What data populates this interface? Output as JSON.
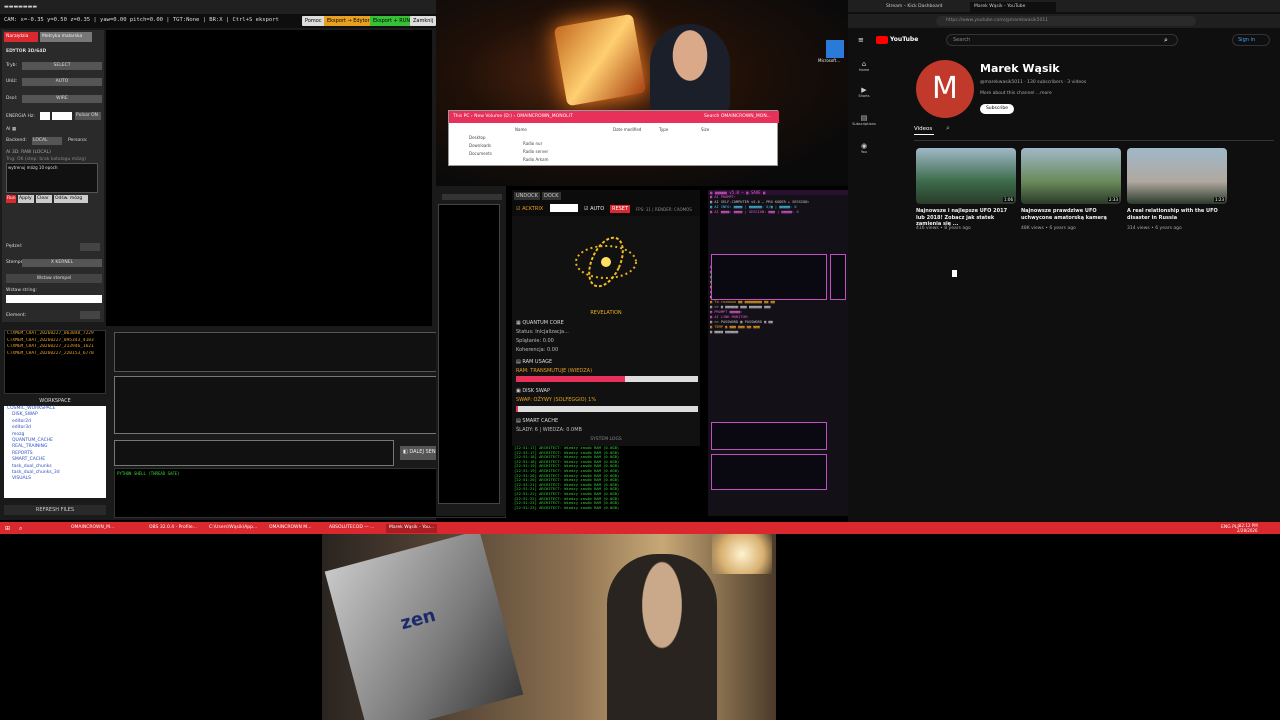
{
  "editor": {
    "window_title": "▬▬▬▬▬▬▬",
    "status": "CAM: x=-0.35 y=0.50 z=0.35 | yaw=0.00 pitch=0.00 | TGT:None | BR:X | Ctrl+S eksport",
    "buttons": {
      "help": "Pomoc",
      "export_editor": "Eksport → Edytor",
      "export_run": "Eksport + RUN",
      "close": "Zamknij"
    },
    "tabs": [
      "Narzędzia",
      "Metryka malarska"
    ],
    "panel_title": "EDYTOR 3D/64D",
    "fields": [
      {
        "label": "Tryb:",
        "value": "SELECT"
      },
      {
        "label": "Ułóż:",
        "value": "AUTO"
      },
      {
        "label": "Dsol:",
        "value": "WIRE"
      }
    ],
    "energia_label": "ENERGIA Hz:",
    "pulsar_label": "Pulsar ON",
    "ai_label": "AI ▦",
    "backend_label": "Backend:",
    "backend_value": "LOCAL",
    "persona_label": "Persona:",
    "ai_status": "AI 3D: RAW (LOCAL)",
    "ai_hint": "Trig: OK (step: brak katalogu mózg)",
    "ai_note": "wytrenuj mózg 10 epoch",
    "action_buttons": [
      "Run",
      "Apply",
      "Clear",
      "Odśw. mózg"
    ],
    "pedzel_label": "Pędzel:",
    "stempel_label": "Stempel:",
    "stempel_value": "X KERNEL",
    "wstaw_stempel": "Wstaw stempel",
    "wstaw_string": "Wstaw string:",
    "element_label": "Element:",
    "files": [
      "CTXMEM_CHAT_20260227_063048_7229",
      "CTXMEM_CHAT_20260227_095343_4183",
      "CTXMEM_CHAT_20260227_213946_1621",
      "CTXMEM_CHAT_20260227_220153_6770"
    ],
    "workspace_title": "WORKSPACE",
    "tree": [
      "COSMIC_WORKSPACE",
      "DISK_SWAP",
      "editor2d",
      "editor3d",
      "mozg",
      "QUANTUM_CACHE",
      "REAL_TRAINING",
      "REPORTS",
      "SMART_CACHE",
      "task_dual_chunks",
      "task_dual_chunks_3d",
      "VISUALS"
    ],
    "refresh": "REFRESH FILES",
    "bottom_buttons": "◧ DALEJ SEND UNDOCK DOCK",
    "console_title": "PYTHON SHELL (THREAD SAFE)"
  },
  "explorer": {
    "path": "This PC › New Volume (D:) › OMAINCROWN_MONOLIT",
    "search": "Search OMAINCROWN_MON...",
    "columns": [
      "Name",
      "Date modified",
      "Type",
      "Size"
    ],
    "sidebar": [
      "Desktop",
      "Downloads",
      "Documents"
    ],
    "rows": [
      "Radio nur",
      "Radio server",
      "Radio Arkam"
    ]
  },
  "desktop_icon": "Microsoft...",
  "quantum": {
    "head_buttons": [
      "UNDOCK",
      "DOCK"
    ],
    "mode": "☑ ACKTRIX",
    "auto": "☑ AUTO",
    "reset": "RESET",
    "fps": "FPS: 31 | RENDER: CAOMOS",
    "revelation": "REVELATION",
    "core_title": "▦ QUANTUM CORE",
    "core_status": "Status: Inicjalizacja...",
    "splatanie": "Splątanie: 0.00",
    "koherencja": "Koherencja: 0.00",
    "ram_title": "▤ RAM USAGE",
    "ram_value": "RAM: TRANSMUTUJE (WIEDZA)",
    "ram_fill": 0.6,
    "disk_title": "▣ DISK SWAP",
    "disk_value": "SWAP: OŻYWY (SOLFEGGIO) 1%",
    "disk_fill": 0.01,
    "cache_title": "▤ SMART CACHE",
    "cache_value": "ŚLADY: 6 | WIEDZA: 0.0MB",
    "logs_title": "SYSTEM LOGS",
    "logs": [
      "[22:51:17] ARCHITECT: Wiedzy zasób RAM (0.0GB)",
      "[22:51:17] ARCHITECT: Wiedzy zasób RAM (0.0GB)",
      "[22:51:18] ARCHITECT: Wiedzy zasób RAM (0.0GB)",
      "[22:51:18] ARCHITECT: Wiedzy zasób RAM (0.0GB)",
      "[22:51:19] ARCHITECT: Wiedzy zasób RAM (0.0GB)",
      "[22:51:19] ARCHITECT: Wiedzy zasób RAM (0.0GB)",
      "[22:51:20] ARCHITECT: Wiedzy zasób RAM (0.0GB)",
      "[22:51:20] ARCHITECT: Wiedzy zasób RAM (0.0GB)",
      "[22:51:21] ARCHITECT: Wiedzy zasób RAM (0.0GB)",
      "[22:51:21] ARCHITECT: Wiedzy zasób RAM (0.0GB)",
      "[22:51:22] ARCHITECT: Wiedzy zasób RAM (0.0GB)",
      "[22:51:22] ARCHITECT: Wiedzy zasób RAM (0.0GB)",
      "[22:51:23] ARCHITECT: Wiedzy zasób RAM (0.0GB)",
      "[22:51:23] ARCHITECT: Wiedzy zasób RAM (0.0GB)"
    ]
  },
  "purple_chat": {
    "header": "▦ ▦▦▦▦▦ v5.0 — ▦ SAVE ▦",
    "lines": [
      "▦ AI PROMPT:",
      "▦ AI SELF-COMPUTER v5.0 — PRO KODER + SESSION:",
      "▦ AI INFO: ▦▦▦▦ | ▦▦▦▦▦▦: 0/▦ | ▦▦▦▦▦: 0",
      "▦ AI ▦▦▦▦: ▦▦▦▦ | SESSION: ▦▦▦ | ▦▦▦▦▦: 0",
      "▦ AI CONSOLE",
      "▦ >> SYSTEM: ▦▦ PROCESSING ▦▦▦▦▦ ▦▦ ▦▦▦▦▦▦▦",
      "▦ >> SYSTEM: ▦▦ PROCESSING ▦▦▦▦▦ ▦▦ ▦▦▦▦▦▦▦",
      "▦ >> SYSTEM: ▦▦ PROCESSING ▦▦▦▦▦ ▦▦ ▦▦▦▦▦▦▦",
      "▦ MEMORY ▦ PTS ▦ ▦ ERROR ▦ ▦ ▦▦▦▦▦▦ ▦",
      "▦ AI > ROM: Gotowy na komunikację.",
      "▦ AI > ▦▦▦▦▦ ▦▦ ▦▦▦▦▦▦",
      "▦ Ta rozmowa ▦▦ ▦▦▦▦▦▦▦▦ ▦▦ ▦▦",
      "▦ >> ▦ ▦▦▦▦▦▦ ▦▦▦ ▦▦▦▦▦▦ ▦▦▦",
      "▦ PROMPT ▦▦▦▦▦:",
      "▦ AI LINK MONITOR:",
      "▦ >> PASSWORD ▦ PASSWORD ▦ ▦▦",
      "▦ TEMP ▦ ▦▦▦ ▦▦▦ ▦▦ ▦▦▦",
      "▦ ▦▦▦▦ ▦▦▦▦▦▦"
    ]
  },
  "youtube": {
    "tabs": [
      "Stream – Kick Dashboard",
      "Marek Wąsik - YouTube"
    ],
    "url": "https://www.youtube.com/@marekwasik5011",
    "logo": "YouTube",
    "search_placeholder": "Search",
    "signin": "Sign in",
    "nav": [
      "Home",
      "Shorts",
      "Subscriptions",
      "You"
    ],
    "avatar_letter": "M",
    "channel_name": "Marek Wąsik",
    "handle_line": "@marekwasik5011 · 130 subscribers · 3 videos",
    "about": "More about this channel ...more",
    "subscribe": "Subscribe",
    "tab_videos": "Videos",
    "videos": [
      {
        "title": "Najnowsze i najlepsze UFO 2017 lub 2018! Zobacz jak statek zamienia się ...",
        "meta": "416 views • 8 years ago",
        "duration": "1:06",
        "color": "#3c6b4a"
      },
      {
        "title": "Najnowsze prawdziwe UFO uchwycone amatorską kamerą",
        "meta": "48K views • 6 years ago",
        "duration": "2:33",
        "color": "#6a8a5a"
      },
      {
        "title": "A real relationship with the UFO disaster in Russia",
        "meta": "314 views • 6 years ago",
        "duration": "1:23",
        "color": "#b0a8a0"
      }
    ]
  },
  "taskbar": {
    "items": [
      "OMAINCROWN_M...",
      "OBS 32.0.4 - Profile...",
      "C:\\Users\\Wąsik\\App...",
      "OMAINCROWN M...",
      "ABSOLUTECOD — ...",
      "Marek Wąsik - You..."
    ],
    "lang": "ENG PLP",
    "time": "12:12 PM",
    "date": "2/28/2026"
  },
  "webcam": {
    "box_text": "zen"
  }
}
